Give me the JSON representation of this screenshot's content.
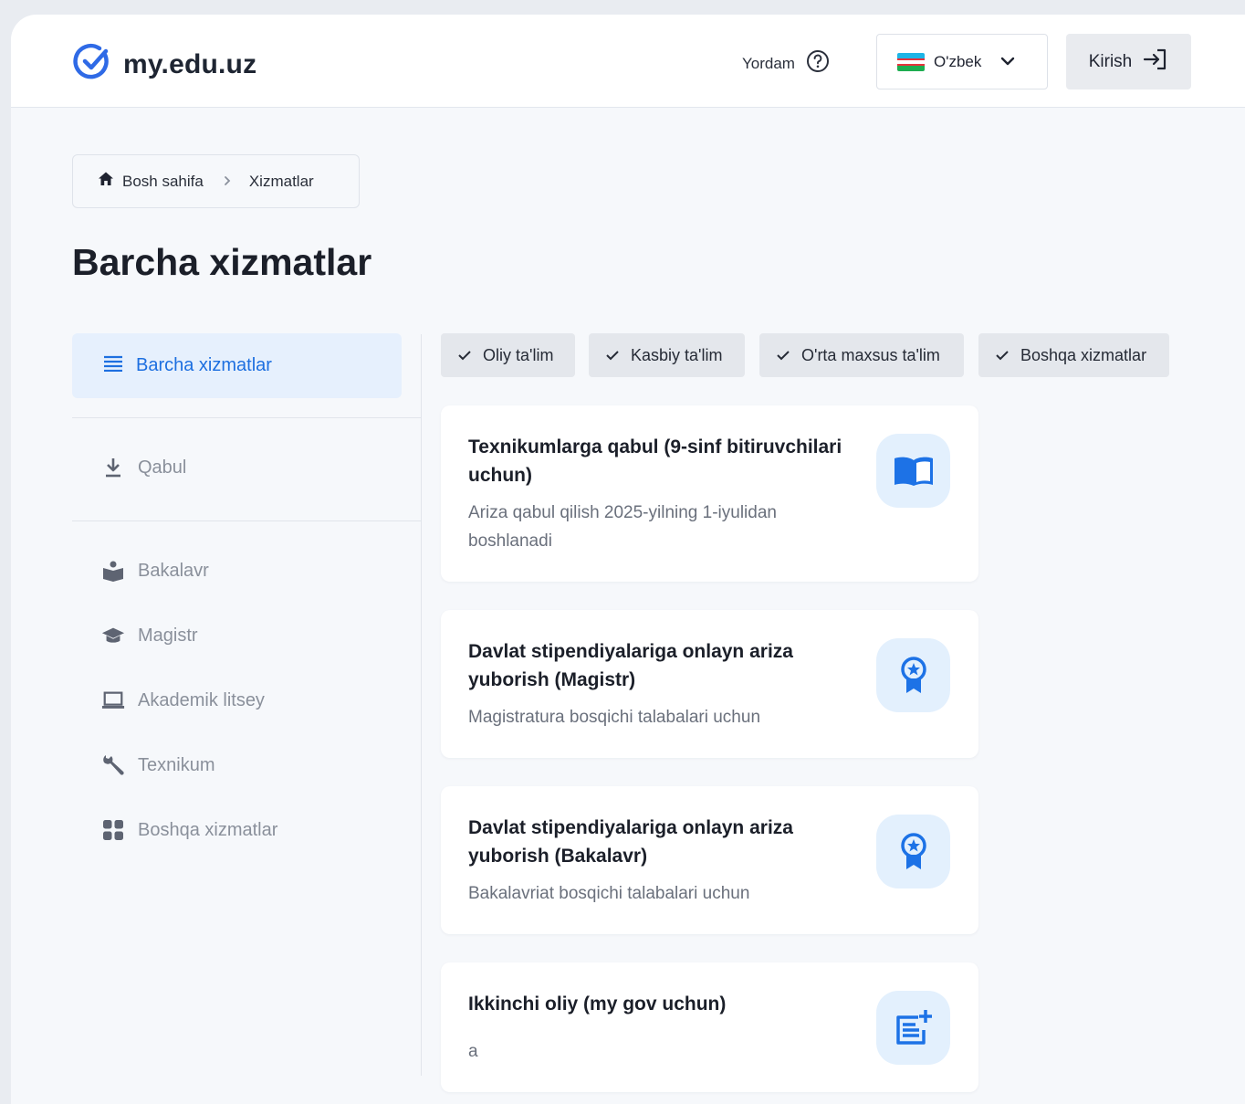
{
  "header": {
    "logo_text": "my.edu.uz",
    "help_label": "Yordam",
    "language": "O'zbek",
    "login_label": "Kirish"
  },
  "breadcrumb": {
    "home": "Bosh sahifa",
    "current": "Xizmatlar"
  },
  "page_title": "Barcha xizmatlar",
  "sidebar": {
    "active": "Barcha xizmatlar",
    "items": [
      {
        "label": "Qabul",
        "icon": "download-icon"
      },
      {
        "label": "Bakalavr",
        "icon": "student-reading-icon"
      },
      {
        "label": "Magistr",
        "icon": "graduation-cap-icon"
      },
      {
        "label": "Akademik litsey",
        "icon": "laptop-icon"
      },
      {
        "label": "Texnikum",
        "icon": "wrench-icon"
      },
      {
        "label": "Boshqa xizmatlar",
        "icon": "grid-icon"
      }
    ]
  },
  "filters": [
    "Oliy ta'lim",
    "Kasbiy ta'lim",
    "O'rta maxsus ta'lim",
    "Boshqa xizmatlar"
  ],
  "cards": [
    {
      "title": "Texnikumlarga qabul (9-sinf bitiruvchilari uchun)",
      "desc": "Ariza qabul qilish 2025-yilning 1-iyulidan boshlanadi",
      "icon": "open-book-icon"
    },
    {
      "title": "Davlat stipendiyalariga onlayn ariza yuborish (Magistr)",
      "desc": "Magistratura bosqichi talabalari uchun",
      "icon": "award-ribbon-icon"
    },
    {
      "title": "Davlat stipendiyalariga onlayn ariza yuborish (Bakalavr)",
      "desc": "Bakalavriat bosqichi talabalari uchun",
      "icon": "award-ribbon-icon"
    },
    {
      "title": "Ikkinchi oliy (my gov uchun)",
      "desc": "a",
      "icon": "add-document-icon"
    }
  ],
  "colors": {
    "accent": "#1d6fe0",
    "icon_bg": "#e3f0fd",
    "page_bg": "#f6f8fb"
  }
}
